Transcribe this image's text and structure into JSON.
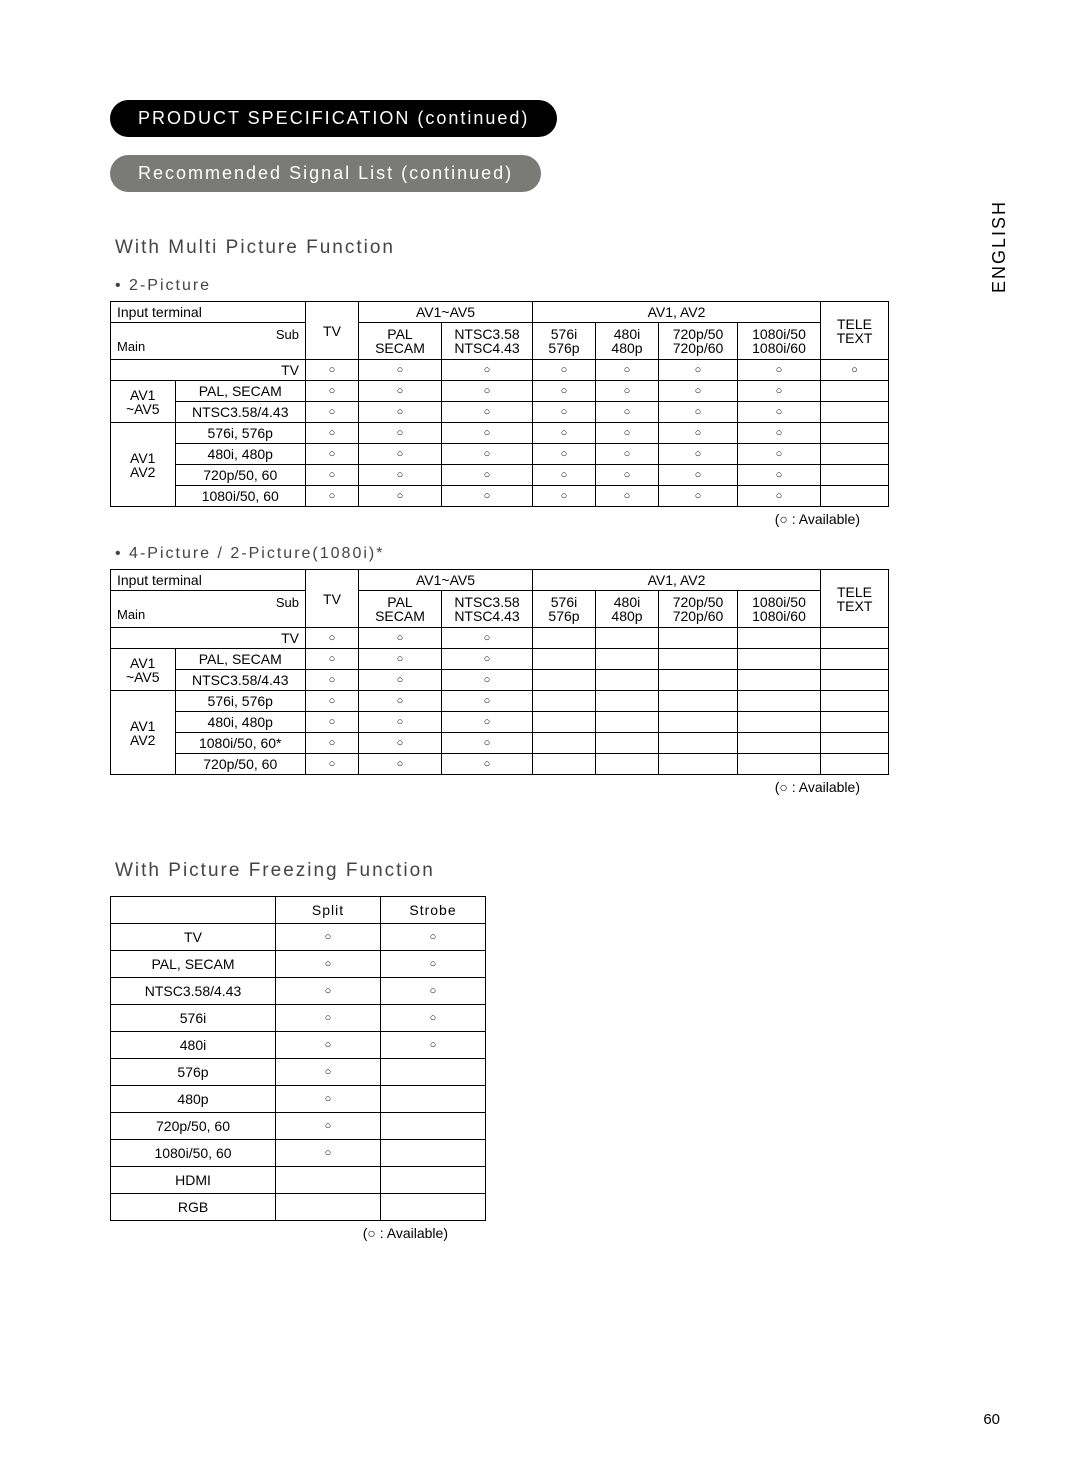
{
  "side_label": "ENGLISH",
  "pill1": "PRODUCT SPECIFICATION (continued)",
  "pill2": "Recommended Signal List (continued)",
  "section1": "With Multi Picture Function",
  "bullet1": "2-Picture",
  "bullet2": "4-Picture / 2-Picture(1080i)*",
  "section2": "With Picture Freezing Function",
  "legend": "(○ : Available)",
  "page_num": "60",
  "headers": {
    "input_terminal": "Input terminal",
    "sub": "Sub",
    "main": "Main",
    "tv": "TV",
    "av1av5": "AV1~AV5",
    "pal": "PAL",
    "secam": "SECAM",
    "ntsc358": "NTSC3.58",
    "ntsc443": "NTSC4.43",
    "av1av2": "AV1, AV2",
    "576i": "576i",
    "576p": "576p",
    "480i": "480i",
    "480p": "480p",
    "720p50": "720p/50",
    "720p60": "720p/60",
    "1080i50": "1080i/50",
    "1080i60": "1080i/60",
    "teletext": "TELE TEXT"
  },
  "rowlabels": {
    "tv": "TV",
    "av1av5": "AV1",
    "av1av5b": "~AV5",
    "av1": "AV1",
    "av2": "AV2",
    "pal_secam": "PAL, SECAM",
    "ntsc_both": "NTSC3.58/4.43",
    "576i576p": "576i, 576p",
    "480i480p": "480i, 480p",
    "720p5060": "720p/50, 60",
    "1080i5060": "1080i/50, 60",
    "1080i5060s": "1080i/50, 60*"
  },
  "t3": {
    "split": "Split",
    "strobe": "Strobe",
    "rows": [
      {
        "name": "TV",
        "split": "○",
        "strobe": "○"
      },
      {
        "name": "PAL, SECAM",
        "split": "○",
        "strobe": "○"
      },
      {
        "name": "NTSC3.58/4.43",
        "split": "○",
        "strobe": "○"
      },
      {
        "name": "576i",
        "split": "○",
        "strobe": "○"
      },
      {
        "name": "480i",
        "split": "○",
        "strobe": "○"
      },
      {
        "name": "576p",
        "split": "○",
        "strobe": ""
      },
      {
        "name": "480p",
        "split": "○",
        "strobe": ""
      },
      {
        "name": "720p/50, 60",
        "split": "○",
        "strobe": ""
      },
      {
        "name": "1080i/50, 60",
        "split": "○",
        "strobe": ""
      },
      {
        "name": "HDMI",
        "split": "",
        "strobe": ""
      },
      {
        "name": "RGB",
        "split": "",
        "strobe": ""
      }
    ]
  }
}
